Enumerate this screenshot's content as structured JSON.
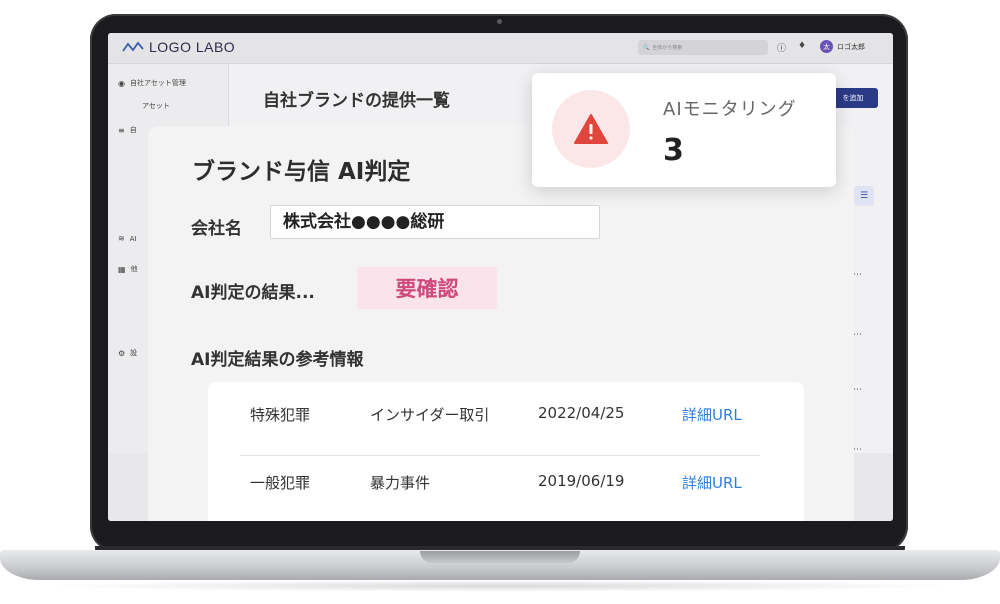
{
  "app": {
    "logo_text": "LOGO LABO",
    "search_placeholder": "全体から検索",
    "user_avatar_char": "太",
    "user_name": "ロゴ太郎"
  },
  "sidebar": {
    "items": [
      {
        "label": "自社アセット管理",
        "icon": "gear-circle-icon"
      },
      {
        "label": "アセット",
        "icon": ""
      },
      {
        "label": "自",
        "icon": "checklist-icon"
      },
      {
        "label": "AI",
        "icon": "ai-chart-icon"
      },
      {
        "label": "他",
        "icon": "building-icon"
      },
      {
        "label": "設",
        "icon": "settings-icon"
      }
    ]
  },
  "page": {
    "title": "自社ブランドの提供一覧",
    "add_button_label": "を追加"
  },
  "modal": {
    "title": "ブランド与信 AI判定",
    "company_label": "会社名",
    "company_value": "株式会社●●●●総研",
    "result_label": "AI判定の結果...",
    "result_value": "要確認",
    "ref_heading": "AI判定結果の参考情報",
    "ref_rows": [
      {
        "category": "特殊犯罪",
        "type": "インサイダー取引",
        "date": "2022/04/25",
        "link": "詳細URL"
      },
      {
        "category": "一般犯罪",
        "type": "暴力事件",
        "date": "2019/06/19",
        "link": "詳細URL"
      }
    ]
  },
  "monitoring": {
    "label": "AIモニタリング",
    "count": "3",
    "icon": "warning-icon",
    "accent_color": "#e0463c"
  }
}
